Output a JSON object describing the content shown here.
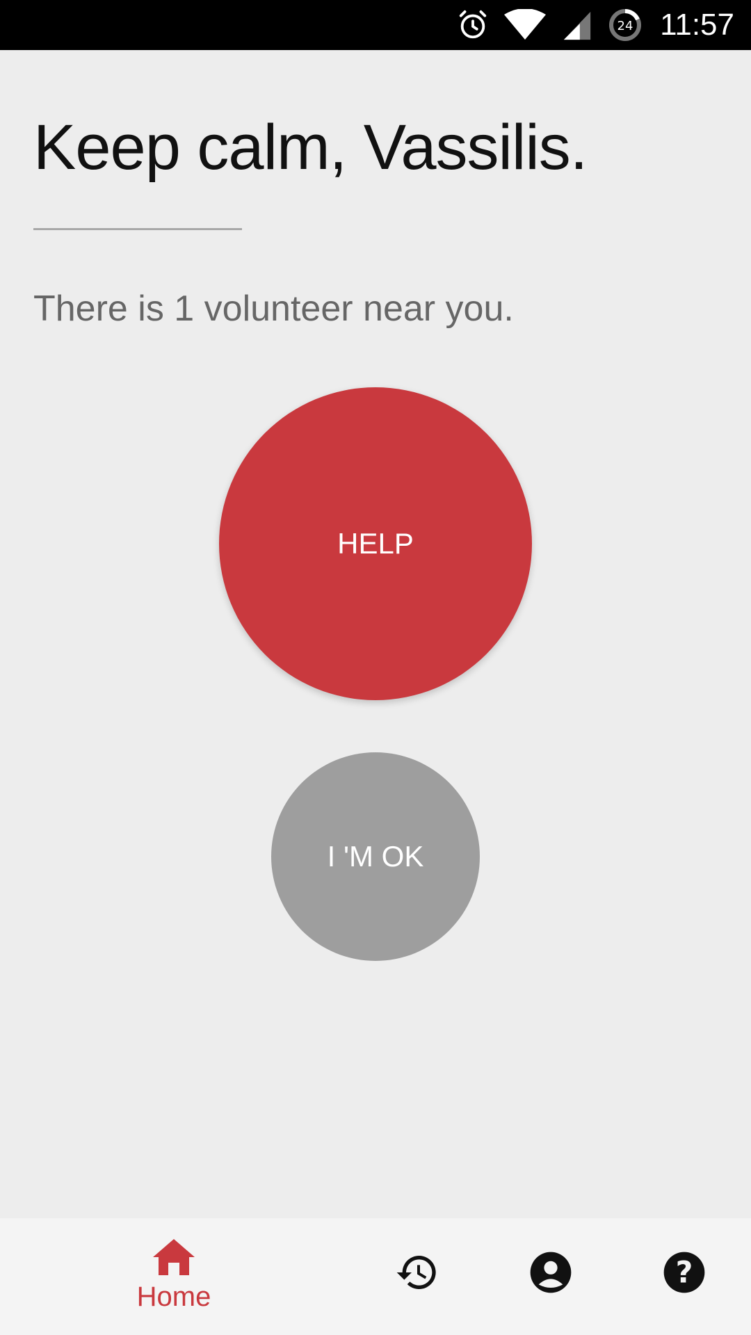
{
  "status_bar": {
    "time": "11:57",
    "battery_text": "24",
    "icons": [
      "alarm-icon",
      "wifi-icon",
      "cell-signal-icon",
      "battery-saver-icon"
    ]
  },
  "main": {
    "greeting": "Keep calm, Vassilis.",
    "volunteer_text": "There is 1 volunteer near you.",
    "help_label": "HELP",
    "ok_label": "I 'M OK"
  },
  "bottom_nav": {
    "home_label": "Home",
    "items": [
      "home-icon",
      "history-icon",
      "account-icon",
      "help-circle-icon"
    ]
  },
  "colors": {
    "accent": "#c9393e",
    "ok_button": "#9e9e9e",
    "background": "#ededed"
  }
}
